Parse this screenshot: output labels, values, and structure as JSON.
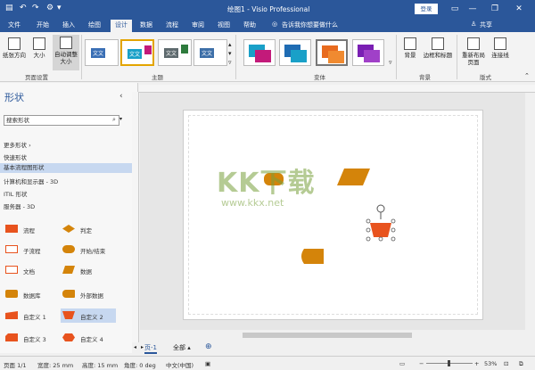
{
  "title_bar": {
    "title": "绘图1 - Visio Professional",
    "login_label": "登录",
    "minimize": "—",
    "restore": "❐",
    "close": "✕",
    "help_icon": "?"
  },
  "tabs": [
    "文件",
    "开始",
    "插入",
    "绘图",
    "设计",
    "数据",
    "流程",
    "审阅",
    "视图",
    "帮助"
  ],
  "active_tab": "设计",
  "tell_me": "告诉我你想要做什么",
  "share": "共享",
  "ribbon": {
    "page_setup": {
      "label": "页面设置",
      "orientation": "纸张方向",
      "size": "大小",
      "autofit": "自动调整大小"
    },
    "themes_label": "主题",
    "theme_text": "文文",
    "variants_label": "变体",
    "background": {
      "label": "背景",
      "bg_button": "背景",
      "borders_button": "边框和标题"
    },
    "layout": {
      "label": "版式",
      "relayout_button": "重新布局页面",
      "connectors_button": "连接线"
    }
  },
  "sidebar": {
    "title": "形状",
    "search_placeholder": "搜索形状",
    "nav": [
      "更多形状",
      "快速形状",
      "基本流程图形状",
      "计算机和显示器 - 3D",
      "ITIL 形状",
      "服务器 - 3D"
    ],
    "selected_nav": "基本流程图形状",
    "shapes": [
      {
        "label": "流程"
      },
      {
        "label": "判定"
      },
      {
        "label": "子流程"
      },
      {
        "label": "开始/结束"
      },
      {
        "label": "文档"
      },
      {
        "label": "数据"
      },
      {
        "label": "数据库"
      },
      {
        "label": "外部数据"
      },
      {
        "label": "自定义 1"
      },
      {
        "label": "自定义 2"
      },
      {
        "label": "自定义 3"
      },
      {
        "label": "自定义 4"
      }
    ]
  },
  "page_tabs": {
    "page": "页-1",
    "all": "全部",
    "add": "⊕"
  },
  "status_bar": {
    "page": "页面 1/1",
    "width": "宽度: 25 mm",
    "height": "高度: 15 mm",
    "angle": "角度: 0 deg",
    "language": "中文(中国)",
    "zoom": "53%"
  },
  "watermark": {
    "main": "KK下载",
    "url": "www.kkx.net"
  },
  "colors": {
    "brand": "#2b579a",
    "shape_orange": "#d4840a",
    "selected_shape": "#e8531e"
  }
}
